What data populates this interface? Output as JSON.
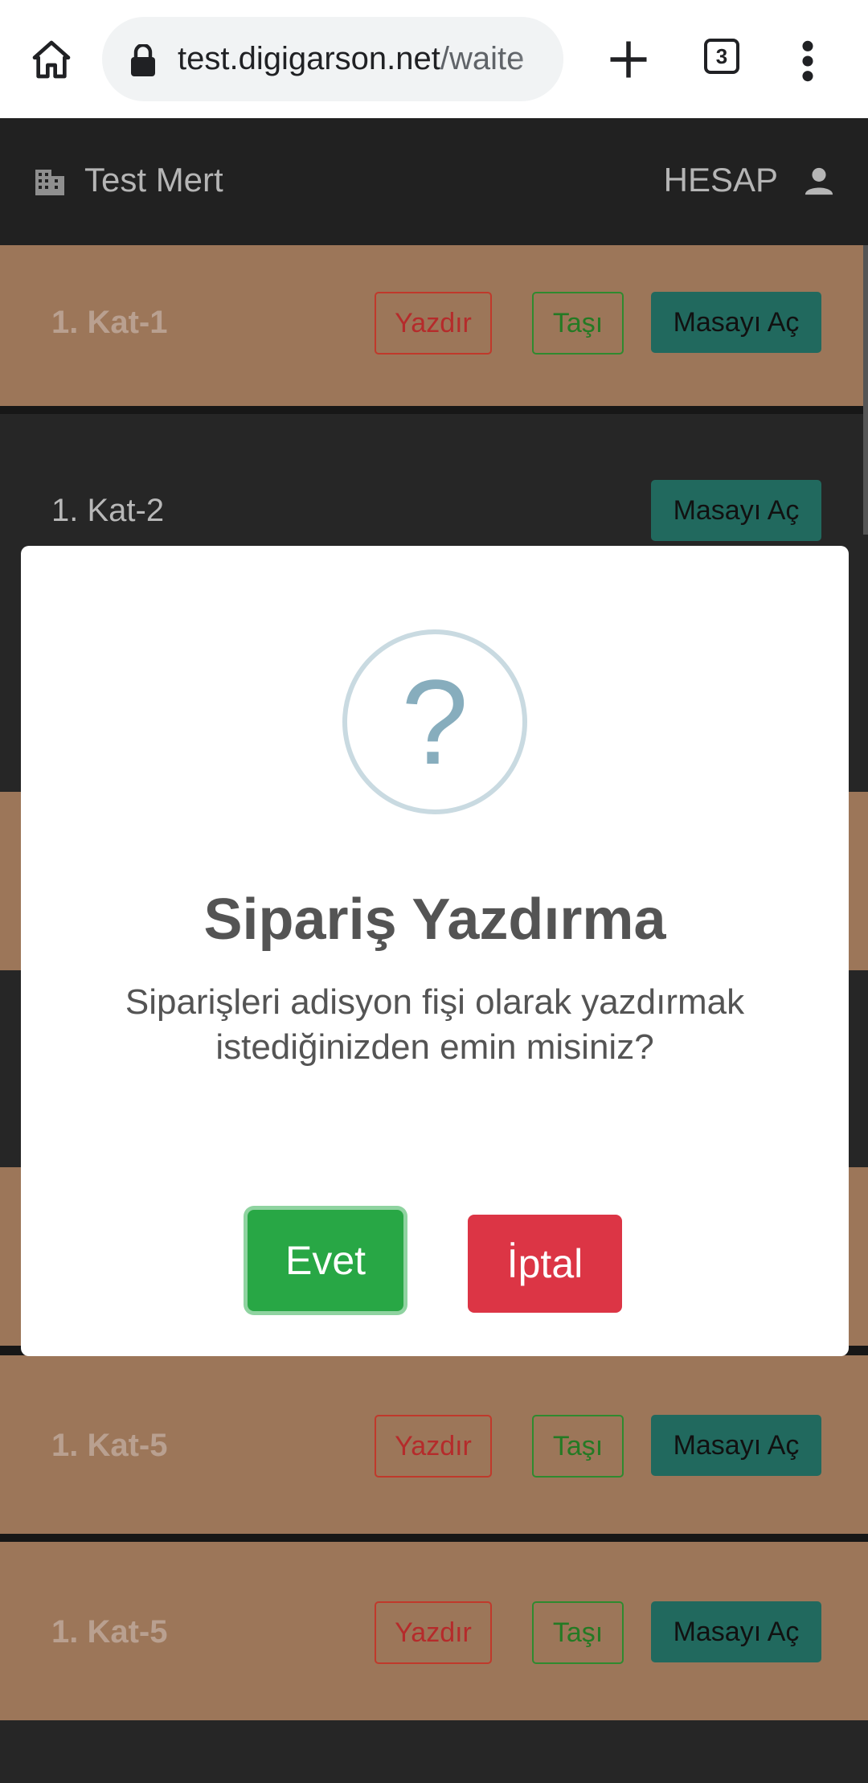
{
  "browser": {
    "url_domain": "test.digigarson.net",
    "url_path": "/waite",
    "tab_count": "3"
  },
  "navbar": {
    "brand": "Test Mert",
    "account": "HESAP"
  },
  "rows": [
    {
      "name": "1. Kat-1",
      "print": "Yazdır",
      "move": "Taşı",
      "open": "Masayı Aç"
    },
    {
      "name": "1. Kat-2",
      "open": "Masayı Aç"
    },
    {
      "name": "1. Kat-5",
      "print": "Yazdır",
      "move": "Taşı",
      "open": "Masayı Aç"
    },
    {
      "name": "1. Kat-5",
      "print": "Yazdır",
      "move": "Taşı",
      "open": "Masayı Aç"
    }
  ],
  "modal": {
    "icon": "?",
    "title": "Sipariş Yazdırma",
    "message": "Siparişleri adisyon fişi olarak yazdırmak istediğinizden emin misiniz?",
    "confirm": "Evet",
    "cancel": "İptal"
  },
  "colors": {
    "row_active": "#9c7659",
    "row_idle": "#262626",
    "open_button": "#21695e",
    "confirm": "#28a745",
    "cancel": "#dc3545"
  }
}
